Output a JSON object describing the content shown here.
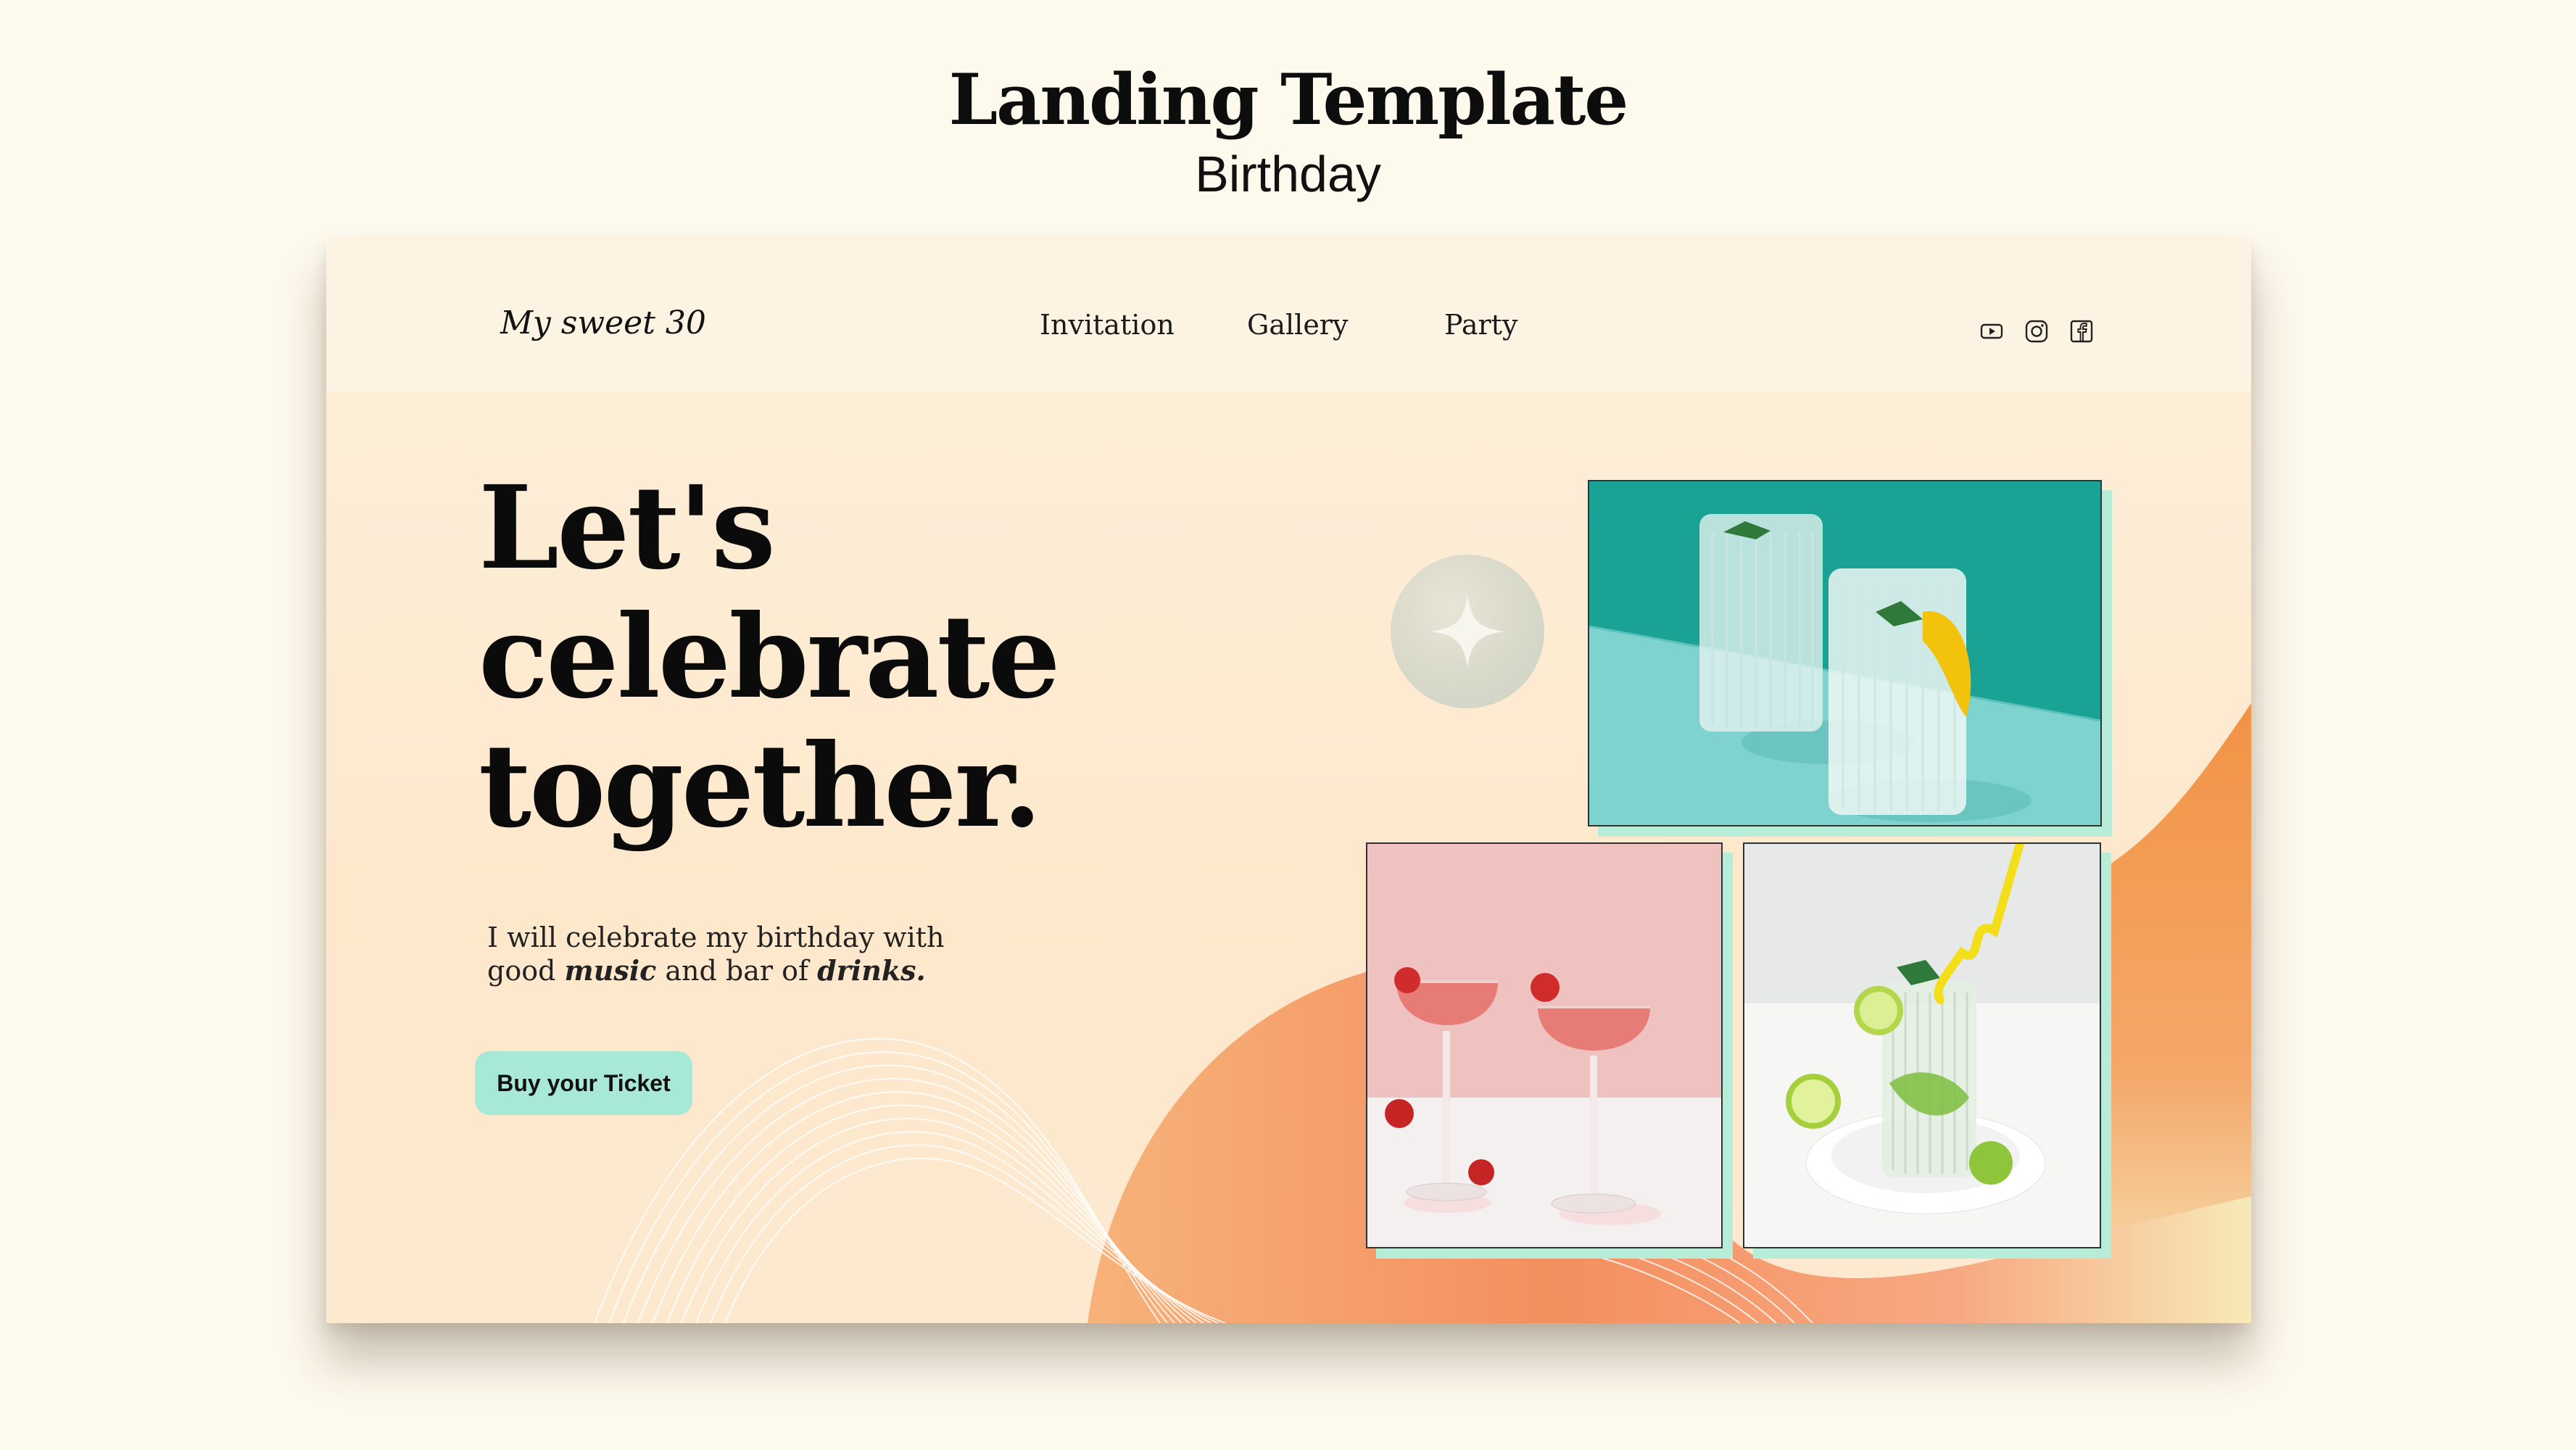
{
  "showcase": {
    "title": "Landing Template",
    "subtitle": "Birthday"
  },
  "navbar": {
    "brand": "My sweet 30",
    "links": [
      {
        "label": "Invitation"
      },
      {
        "label": "Gallery"
      },
      {
        "label": "Party"
      }
    ],
    "social_icons": [
      "youtube-icon",
      "instagram-icon",
      "facebook-icon"
    ]
  },
  "hero": {
    "title_lines": [
      "Let's",
      "celebrate",
      "together."
    ],
    "description": {
      "part1": "I will celebrate my birthday with good ",
      "emph1": "music",
      "part2": " and bar of ",
      "emph2": "drinks."
    },
    "cta_label": "Buy your Ticket"
  },
  "gallery": {
    "photos": [
      {
        "name": "lemonade-glasses-photo"
      },
      {
        "name": "pink-cocktails-photo"
      },
      {
        "name": "mojito-glass-photo"
      }
    ]
  },
  "colors": {
    "background": "#fdf9ec",
    "card_top": "#fdf0dc",
    "accent_orange": "#f4934b",
    "cta_mint": "#a8e8d6",
    "photo_shadow": "#b7ecd9",
    "text": "#111111"
  }
}
